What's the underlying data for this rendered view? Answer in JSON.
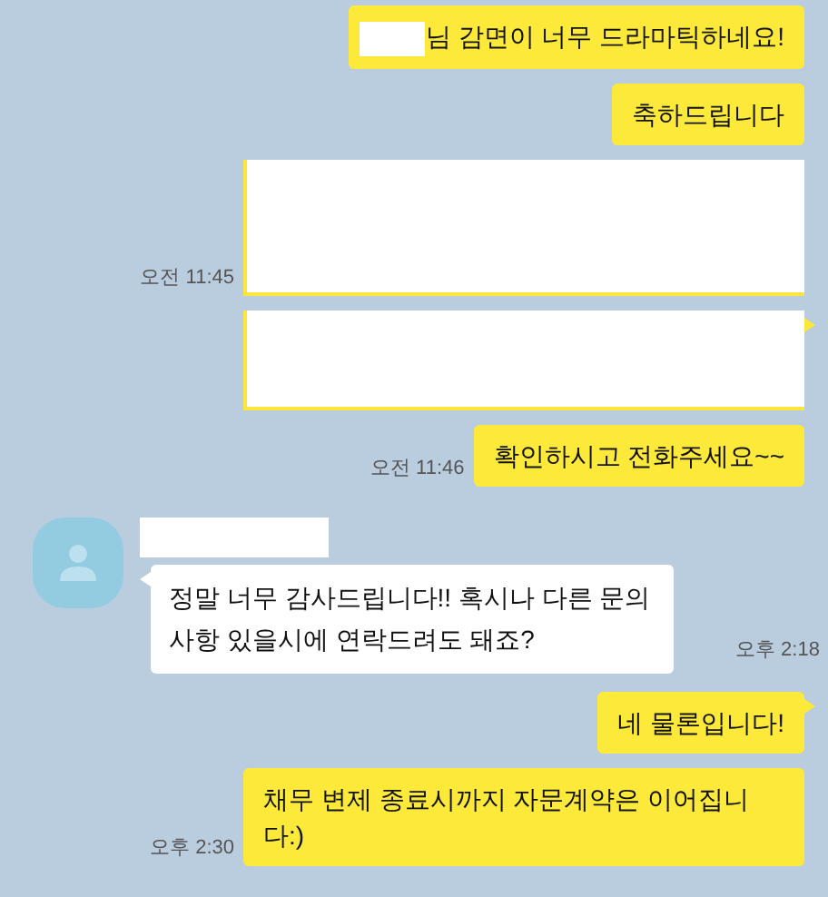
{
  "messages": [
    {
      "kind": "sent",
      "redacted_prefix": true,
      "text": "님 감면이 너무 드라마틱하네요!",
      "tail": false
    },
    {
      "kind": "sent",
      "redacted_prefix": false,
      "text": "축하드립니다",
      "tail": false
    },
    {
      "kind": "sent-redacted",
      "tall": true,
      "time": "오전 11:45",
      "tail": false
    },
    {
      "kind": "sent-redacted",
      "tall": false,
      "tail": true
    },
    {
      "kind": "sent",
      "redacted_prefix": false,
      "text": "확인하시고 전화주세요~~",
      "time": "오전 11:46",
      "tail": false
    },
    {
      "kind": "received",
      "name_redacted": true,
      "text": "정말 너무 감사드립니다!! 혹시나 다른 문의사항 있을시에 연락드려도 돼죠?",
      "time": "오후 2:18",
      "tail": true
    },
    {
      "kind": "sent",
      "redacted_prefix": false,
      "text": "네 물론입니다!",
      "tail": true
    },
    {
      "kind": "sent",
      "redacted_prefix": false,
      "text": "채무 변제 종료시까지 자문계약은 이어집니다:)",
      "time": "오후 2:30",
      "tail": false
    }
  ]
}
